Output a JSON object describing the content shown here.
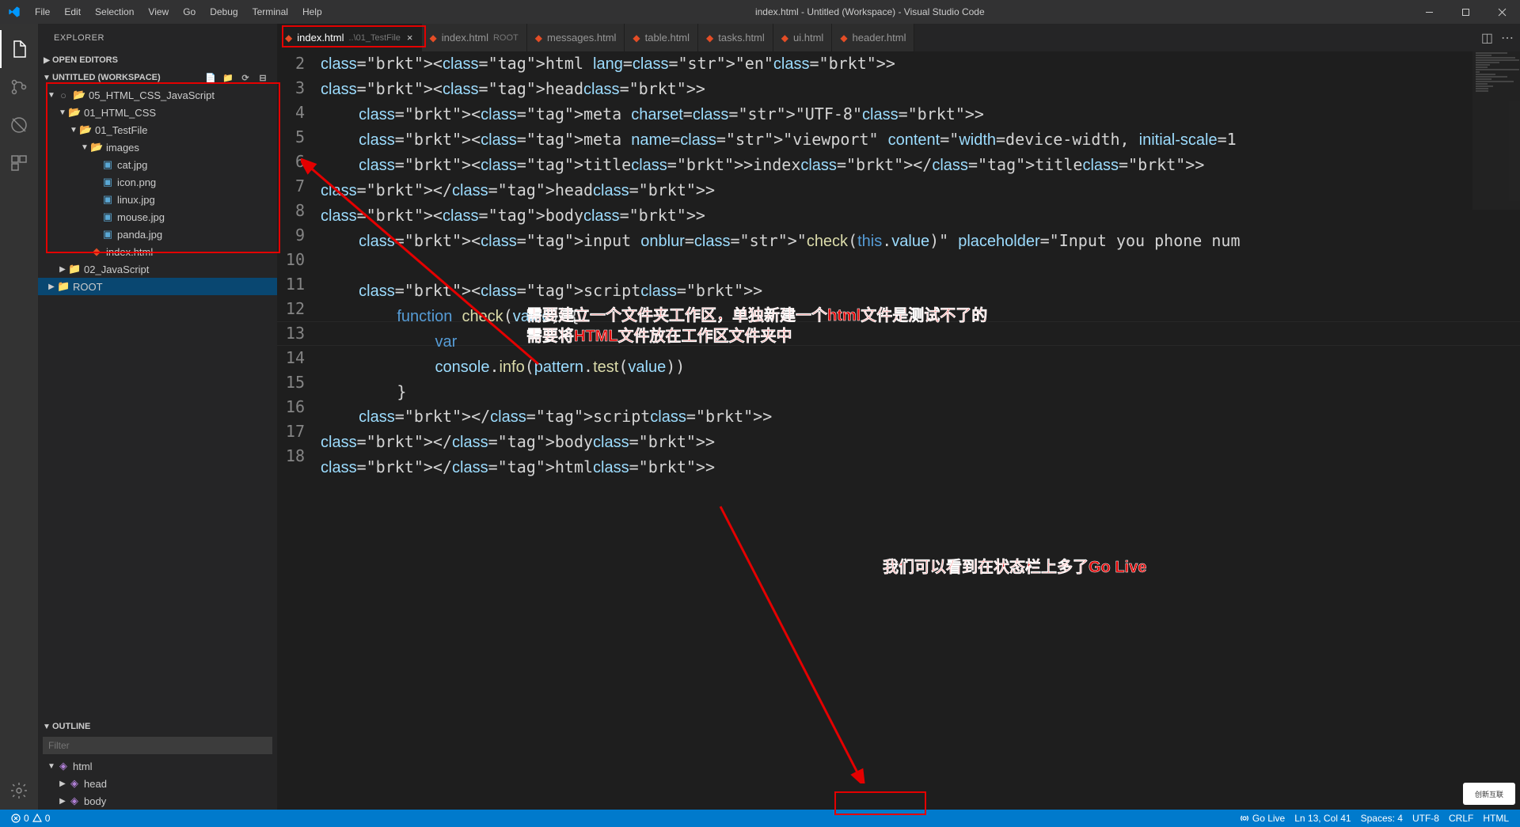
{
  "titlebar": {
    "menus": [
      "File",
      "Edit",
      "Selection",
      "View",
      "Go",
      "Debug",
      "Terminal",
      "Help"
    ],
    "title": "index.html - Untitled (Workspace) - Visual Studio Code"
  },
  "activity": [
    "files",
    "scm",
    "debug",
    "extensions",
    "test"
  ],
  "sidebar": {
    "title": "EXPLORER",
    "openEditors": "OPEN EDITORS",
    "workspace": "UNTITLED (WORKSPACE)",
    "outline": "OUTLINE",
    "filterPlaceholder": "Filter",
    "tree": [
      {
        "d": 0,
        "t": "folder-open",
        "exp": true,
        "label": "05_HTML_CSS_JavaScript",
        "circle": true
      },
      {
        "d": 1,
        "t": "folder-open",
        "exp": true,
        "label": "01_HTML_CSS"
      },
      {
        "d": 2,
        "t": "folder-open",
        "exp": true,
        "label": "01_TestFile"
      },
      {
        "d": 3,
        "t": "folder-img",
        "exp": true,
        "label": "images"
      },
      {
        "d": 4,
        "t": "img",
        "label": "cat.jpg"
      },
      {
        "d": 4,
        "t": "img",
        "label": "icon.png"
      },
      {
        "d": 4,
        "t": "img",
        "label": "linux.jpg"
      },
      {
        "d": 4,
        "t": "img",
        "label": "mouse.jpg"
      },
      {
        "d": 4,
        "t": "img",
        "label": "panda.jpg"
      },
      {
        "d": 3,
        "t": "html",
        "label": "index.html"
      },
      {
        "d": 1,
        "t": "folder",
        "exp": false,
        "label": "02_JavaScript"
      },
      {
        "d": 0,
        "t": "folder",
        "exp": false,
        "label": "ROOT",
        "selected": true
      }
    ],
    "outlineTree": [
      {
        "d": 0,
        "t": "sym",
        "exp": true,
        "label": "html"
      },
      {
        "d": 1,
        "t": "sym",
        "exp": false,
        "label": "head"
      },
      {
        "d": 1,
        "t": "sym",
        "exp": false,
        "label": "body"
      }
    ]
  },
  "tabs": [
    {
      "label": "index.html",
      "desc": "..\\01_TestFile",
      "active": true,
      "close": true
    },
    {
      "label": "index.html",
      "desc": "ROOT"
    },
    {
      "label": "messages.html"
    },
    {
      "label": "table.html"
    },
    {
      "label": "tasks.html"
    },
    {
      "label": "ui.html"
    },
    {
      "label": "header.html"
    }
  ],
  "code": {
    "start": 2,
    "lines": [
      "<html lang=\"en\">",
      "<head>",
      "    <meta charset=\"UTF-8\">",
      "    <meta name=\"viewport\" content=\"width=device-width, initial-scale=1",
      "    <title>index</title>",
      "</head>",
      "<body>",
      "    <input onblur=\"check(this.value)\" placeholder=\"Input you phone num",
      "",
      "    <script>",
      "        function check(value) {",
      "            var",
      "            console.info(pattern.test(value))",
      "        }",
      "    </script>",
      "</body>",
      "</html>"
    ],
    "currentLine": 13
  },
  "annotations": {
    "line1": "需要建立一个文件夹工作区，单独新建一个html文件是测试不了的",
    "line2": "需要将HTML文件放在工作区文件夹中",
    "line3": "我们可以看到在状态栏上多了Go Live"
  },
  "status": {
    "errors": "0",
    "warnings": "0",
    "golive": "Go Live",
    "lncol": "Ln 13, Col 41",
    "spaces": "Spaces: 4",
    "encoding": "UTF-8",
    "eol": "CRLF",
    "lang": "HTML"
  },
  "watermark": "创新互联"
}
